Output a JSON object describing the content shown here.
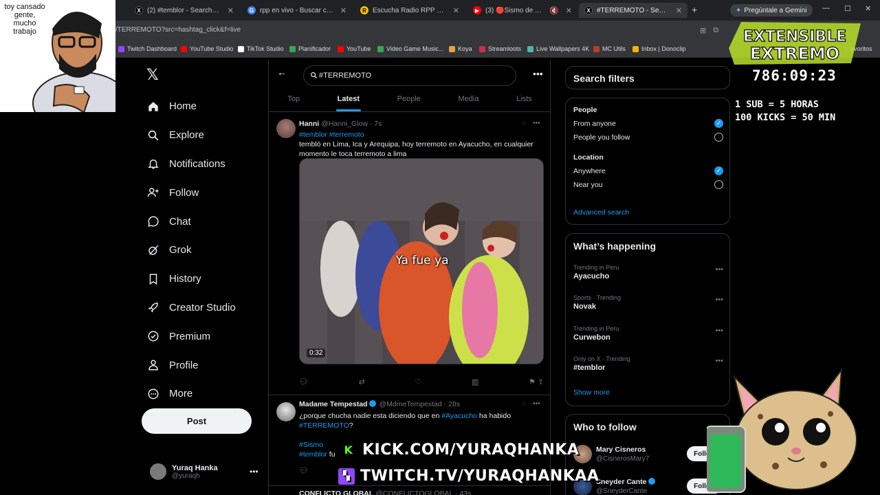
{
  "browser": {
    "tabs": [
      {
        "title": "(2) #temblor - Search / X",
        "fav": "X",
        "color": "#000000"
      },
      {
        "title": "rpp en vivo - Buscar con Google",
        "fav": "G",
        "color": "#4285f4"
      },
      {
        "title": "Escucha Radio RPP Player EN VIVO",
        "fav": "R",
        "color": "#f2c200"
      },
      {
        "title": "(3) 🔴Sismo de 7.2 en AYACUCHO",
        "fav": "▶",
        "color": "#ff0000"
      },
      {
        "title": "#TERREMOTO - Search / X",
        "fav": "X",
        "color": "#000000"
      }
    ],
    "gemini_label": "Pregúntale a Gemini",
    "url": "/TERREMOTO?src=hashtag_click&f=live",
    "bookmarks": [
      {
        "label": "Twitch Dashboard",
        "color": "#9146ff"
      },
      {
        "label": "YouTube Studio",
        "color": "#ff0000"
      },
      {
        "label": "TikTok Studio",
        "color": "#ffffff"
      },
      {
        "label": "Planificador",
        "color": "#34a853"
      },
      {
        "label": "YouTube",
        "color": "#ff0000"
      },
      {
        "label": "Video Game Music...",
        "color": "#34a853"
      },
      {
        "label": "Koya",
        "color": "#e8a040"
      },
      {
        "label": "Streamloots",
        "color": "#d02b4a"
      },
      {
        "label": "Live Wallpapers 4K",
        "color": "#4db6ac"
      },
      {
        "label": "MC Utils",
        "color": "#c0392b"
      },
      {
        "label": "Inbox | Donoclip",
        "color": "#f5b400"
      }
    ],
    "bookmarks_right": "avoritos"
  },
  "nav": {
    "items": [
      {
        "label": "Home",
        "icon": "home-icon"
      },
      {
        "label": "Explore",
        "icon": "search-icon"
      },
      {
        "label": "Notifications",
        "icon": "bell-icon"
      },
      {
        "label": "Follow",
        "icon": "follow-icon"
      },
      {
        "label": "Chat",
        "icon": "chat-icon"
      },
      {
        "label": "Grok",
        "icon": "grok-icon"
      },
      {
        "label": "History",
        "icon": "bookmark-icon"
      },
      {
        "label": "Creator Studio",
        "icon": "rocket-icon"
      },
      {
        "label": "Premium",
        "icon": "verified-icon"
      },
      {
        "label": "Profile",
        "icon": "person-icon"
      },
      {
        "label": "More",
        "icon": "more-circle-icon"
      }
    ],
    "post_label": "Post",
    "account": {
      "name": "Yuraq Hanka",
      "handle": "@yuraqh"
    }
  },
  "search": {
    "query": "#TERREMOTO",
    "tabs": [
      "Top",
      "Latest",
      "People",
      "Media",
      "Lists"
    ],
    "active_tab": "Latest"
  },
  "tweets": [
    {
      "name": "Hanni",
      "meta": "@Hanni_Glow · 7s",
      "hashtags": "#temblor #terremoto",
      "text": "tembló en Lima, Ica y Arequipa, hoy terremoto en Ayacucho, en cualquier momento le toca terremoto a lima",
      "media_caption": "Ya fue ya",
      "media_duration": "0:32"
    },
    {
      "name": "Madame Tempestad",
      "meta": "@MdmeTempestad · 28s",
      "text_a": "¿porque chucha nadie esta diciendo que en ",
      "text_ht1": "#Ayacucho",
      "text_b": " ha habido",
      "text_ht2": "#TERREMOTO",
      "text_c": "?",
      "tags1": "#Sismo",
      "tags2": "#temblor",
      "tail": " fu"
    },
    {
      "name": "CONFLICTO GLOBAL",
      "meta": "@CONFLICTOGLOBAL · 43s"
    }
  ],
  "filters": {
    "title": "Search filters",
    "people_title": "People",
    "people_options": [
      "From anyone",
      "People you follow"
    ],
    "location_title": "Location",
    "location_options": [
      "Anywhere",
      "Near you"
    ],
    "advanced": "Advanced search"
  },
  "happening": {
    "title": "What’s happening",
    "trends": [
      {
        "category": "Trending in Peru",
        "term": "Ayacucho"
      },
      {
        "category": "Sports · Trending",
        "term": "Novak"
      },
      {
        "category": "Trending in Peru",
        "term": "Curwebon"
      },
      {
        "category": "Only on X · Trending",
        "term": "#temblor"
      }
    ],
    "show_more": "Show more"
  },
  "who_to_follow": {
    "title": "Who to follow",
    "users": [
      {
        "name": "Mary Cisneros",
        "handle": "@CisnerosMary7"
      },
      {
        "name": "Sneyder Cante",
        "handle": "@SneyderCante"
      }
    ],
    "follow_label": "Follow"
  },
  "overlay": {
    "webcam_text": "toy cansado gente, mucho trabajo",
    "logo_line1": "EXTENSIBLE",
    "logo_line2": "EXTREMO",
    "timer": "786:09:23",
    "rule1": "1 SUB = 5 HORAS",
    "rule2": "100 KICKS = 50 MIN",
    "kick_url": "KICK.COM/YURAQHANKA",
    "twitch_url": "TWITCH.TV/YURAQHANKAA",
    "kick_color": "#53fc18",
    "twitch_color": "#9146ff"
  }
}
